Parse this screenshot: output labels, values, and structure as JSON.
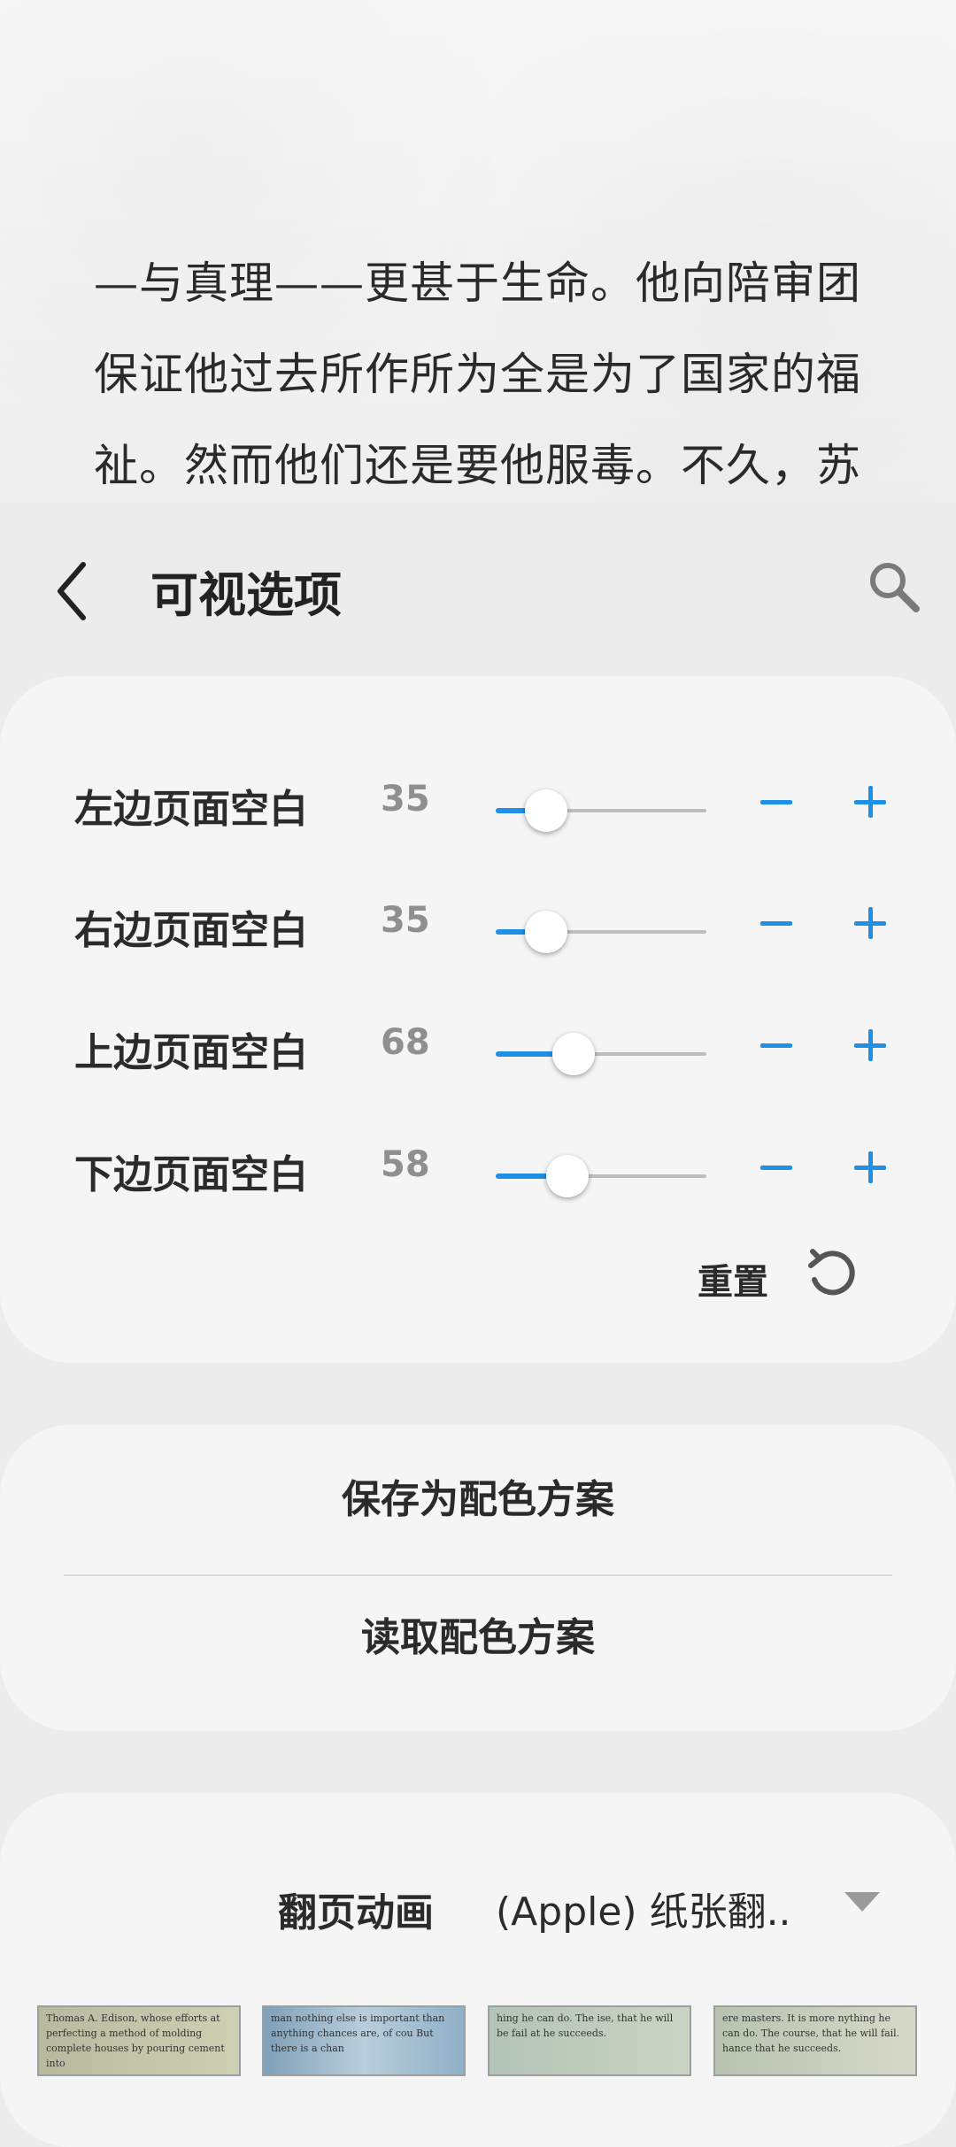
{
  "reading": {
    "lines": [
      "—与真理——更甚于生命。他向陪审团",
      "保证他过去所作所为全是为了国家的福",
      "祉。然而他们还是要他服毒。不久，苏"
    ]
  },
  "header": {
    "title": "可视选项",
    "back_icon": "chevron-left-icon",
    "search_icon": "search-icon"
  },
  "margins": {
    "rows": [
      {
        "label": "左边页面空白",
        "value": "35",
        "fraction": 0.24
      },
      {
        "label": "右边页面空白",
        "value": "35",
        "fraction": 0.24
      },
      {
        "label": "上边页面空白",
        "value": "68",
        "fraction": 0.37
      },
      {
        "label": "下边页面空白",
        "value": "58",
        "fraction": 0.34
      }
    ],
    "reset_label": "重置",
    "accent_color": "#1e90e6"
  },
  "scheme": {
    "save_label": "保存为配色方案",
    "load_label": "读取配色方案"
  },
  "animation": {
    "label": "翻页动画",
    "selected": "(Apple) 纸张翻..",
    "thumbnails": [
      "Thomas A. Edison, whose efforts at perfecting a method of molding complete houses by pouring cement into",
      "man nothing else is important than anything chances are, of cou But there is a chan",
      "hing he can do. The ise, that he will be fail at he succeeds.",
      "ere masters. It is more nything he can do. The course, that he will fail. hance that he succeeds."
    ]
  }
}
